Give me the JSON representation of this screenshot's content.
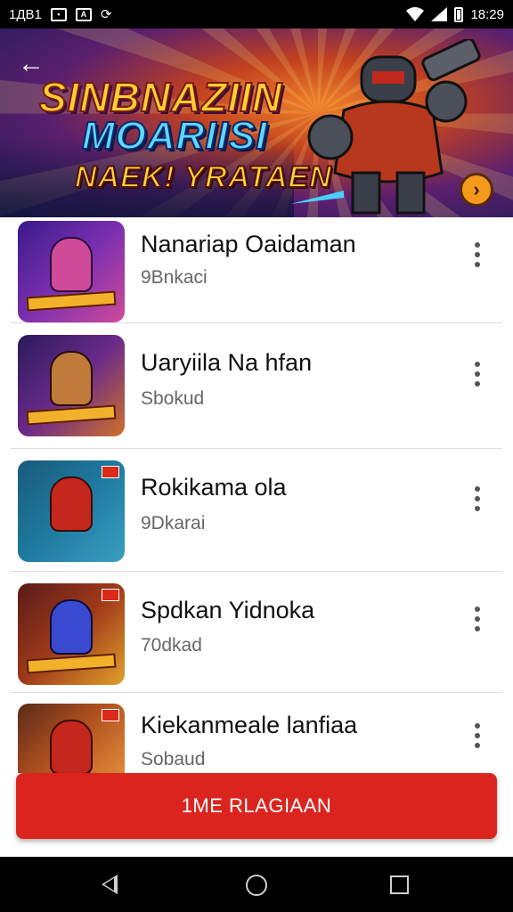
{
  "status_bar": {
    "left_text": "1ДB1",
    "icons": [
      "gallery-icon",
      "a-app-icon",
      "sync-icon"
    ],
    "right_icons": [
      "wifi-icon",
      "signal-icon",
      "battery-icon"
    ],
    "time": "18:29"
  },
  "banner": {
    "line1": "SINBNAZIIN",
    "line2": "MOARIISI",
    "line3": "NAEK! YRATAEN",
    "back_icon": "arrow-left-icon",
    "next_icon": "chevron-right-icon",
    "next_glyph": "›"
  },
  "list": {
    "items": [
      {
        "title": "Nanariap Oaidaman",
        "subtitle": "9Bnkaci",
        "thumb_color": "#7a2fb0",
        "fig_color": "#d04a9a"
      },
      {
        "title": "Uaryiila Na hfan",
        "subtitle": "Sbokud",
        "thumb_color": "#6a2a8a",
        "fig_color": "#c07a3a"
      },
      {
        "title": "Rokikama ola",
        "subtitle": "9Dkarai",
        "thumb_color": "#1e7aa0",
        "fig_color": "#c4281c"
      },
      {
        "title": "Spdkan Yidnoka",
        "subtitle": "70dkad",
        "thumb_color": "#a03a1a",
        "fig_color": "#3a4ad0"
      },
      {
        "title": "Kiekanmeale lanfiaa",
        "subtitle": "Sobaud",
        "thumb_color": "#b0501e",
        "fig_color": "#c4281c"
      }
    ],
    "more_icon": "more-vertical-icon"
  },
  "cta": {
    "label": "1ME RLAGIAAN"
  },
  "nav_bar": {
    "icons": [
      "back-triangle-icon",
      "home-circle-icon",
      "recents-square-icon"
    ]
  }
}
